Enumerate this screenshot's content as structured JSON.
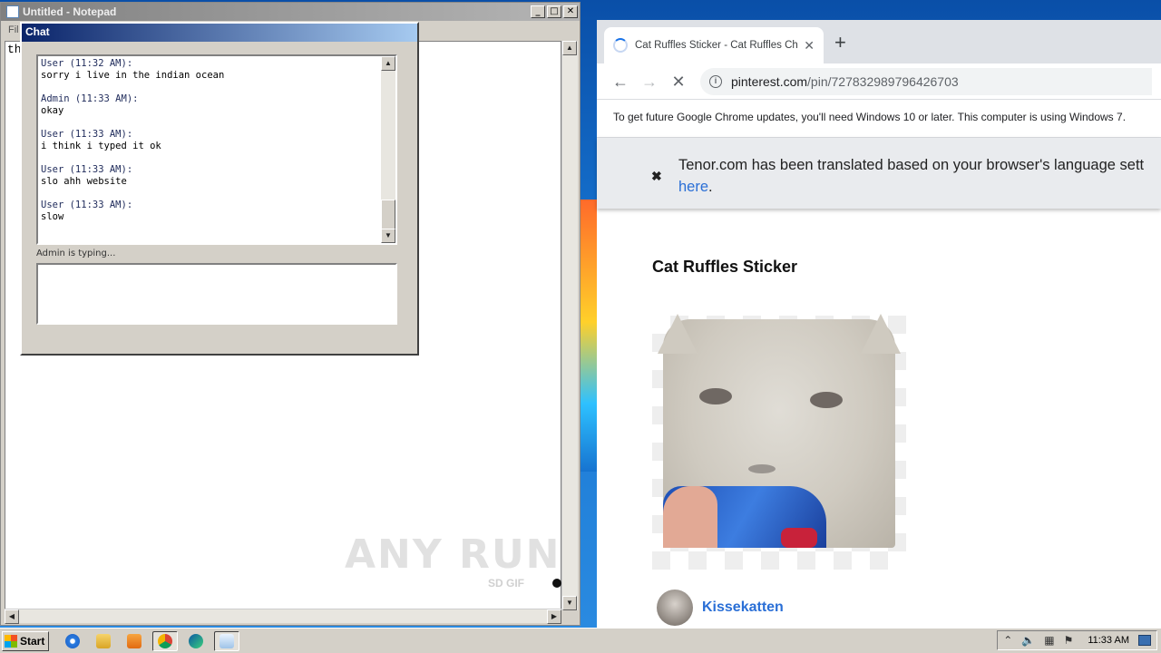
{
  "notepad": {
    "title": "Untitled - Notepad",
    "menu_partial": "Fil",
    "content": "th"
  },
  "chat": {
    "title": "Chat",
    "messages": [
      {
        "header": "User (11:32 AM):",
        "text": "sorry i live in the indian ocean"
      },
      {
        "header": "Admin (11:33 AM):",
        "text": "okay"
      },
      {
        "header": "User (11:33 AM):",
        "text": "i think i typed it ok"
      },
      {
        "header": "User (11:33 AM):",
        "text": "slo ahh website"
      },
      {
        "header": "User (11:33 AM):",
        "text": "slow"
      }
    ],
    "typing_status": "Admin is typing...",
    "input_value": ""
  },
  "browser": {
    "tab_title": "Cat Ruffles Sticker - Cat Ruffles Chi",
    "new_tab": "+",
    "url_host": "pinterest.com",
    "url_path": "/pin/727832989796426703",
    "update_notice": "To get future Google Chrome updates, you'll need Windows 10 or later. This computer is using Windows 7.",
    "translate_notice": "Tenor.com has been translated based on your browser's language sett",
    "translate_link": "here",
    "translate_period": ".",
    "page_title": "Cat Ruffles Sticker",
    "author_name": "Kissekatten",
    "watermark": "ANY RUN",
    "sd_gif": "SD GIF"
  },
  "taskbar": {
    "start_label": "Start",
    "clock": "11:33 AM",
    "pinned_icons": [
      "ie-icon",
      "explorer-icon",
      "media-player-icon",
      "chrome-icon",
      "edge-icon",
      "notepad-icon"
    ]
  },
  "colors": {
    "chat_titlebar": "#0a246a",
    "link_blue": "#2a6fd6"
  }
}
